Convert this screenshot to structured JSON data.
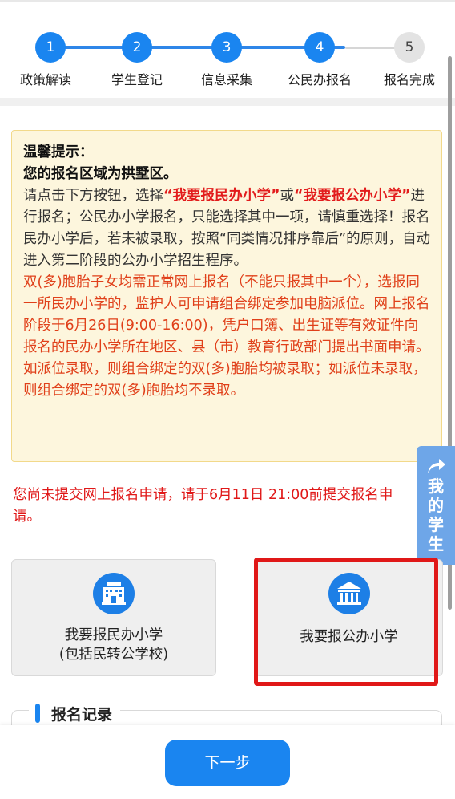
{
  "steps": [
    {
      "number": "1",
      "label": "政策解读",
      "state": "done"
    },
    {
      "number": "2",
      "label": "学生登记",
      "state": "done"
    },
    {
      "number": "3",
      "label": "信息采集",
      "state": "done"
    },
    {
      "number": "4",
      "label": "公民办报名",
      "state": "current"
    },
    {
      "number": "5",
      "label": "报名完成",
      "state": "pending"
    }
  ],
  "notice": {
    "title": "温馨提示：",
    "region": "您的报名区域为拱墅区。",
    "p1_a": "请点击下方按钮，选择",
    "p1_opt1": "“我要报民办小学”",
    "p1_or": "或",
    "p1_opt2": "“我要报公办小学”",
    "p1_b": "进行报名；公民办小学报名，只能选择其中一项，请慎重选择！报名民办小学后，若未被录取，按照“同类情况排序靠后”的原则，自动进入第二阶段的公办小学招生程序。",
    "twins": "双(多)胞胎子女均需正常网上报名（不能只报其中一个），选报同一所民办小学的，监护人可申请组合绑定参加电脑派位。网上报名阶段于6月26日(9:00-16:00)，凭户口簿、出生证等有效证件向报名的民办小学所在地区、县（市）教育行政部门提出书面申请。如派位录取，则组合绑定的双(多)胞胎均被录取；如派位未录取，则组合绑定的双(多)胞胎均不录取。"
  },
  "registration_message": "您尚未提交网上报名申请，请于6月11日 21:00前提交报名申请。",
  "float_tab": {
    "line1": "我",
    "line2": "的",
    "line3": "学",
    "line4": "生"
  },
  "options": {
    "private": {
      "line1": "我要报民办小学",
      "line2": "(包括民转公学校)"
    },
    "public": {
      "line1": "我要报公办小学"
    }
  },
  "records": {
    "title": "报名记录"
  },
  "next_button": "下一步",
  "colors": {
    "accent": "#1a85f0",
    "warning": "#e01818",
    "notice_bg": "#fdf6dd"
  },
  "icons": {
    "private_school": "school-building-icon",
    "public_school": "institution-icon",
    "float_tab": "share-arrow-icon"
  }
}
